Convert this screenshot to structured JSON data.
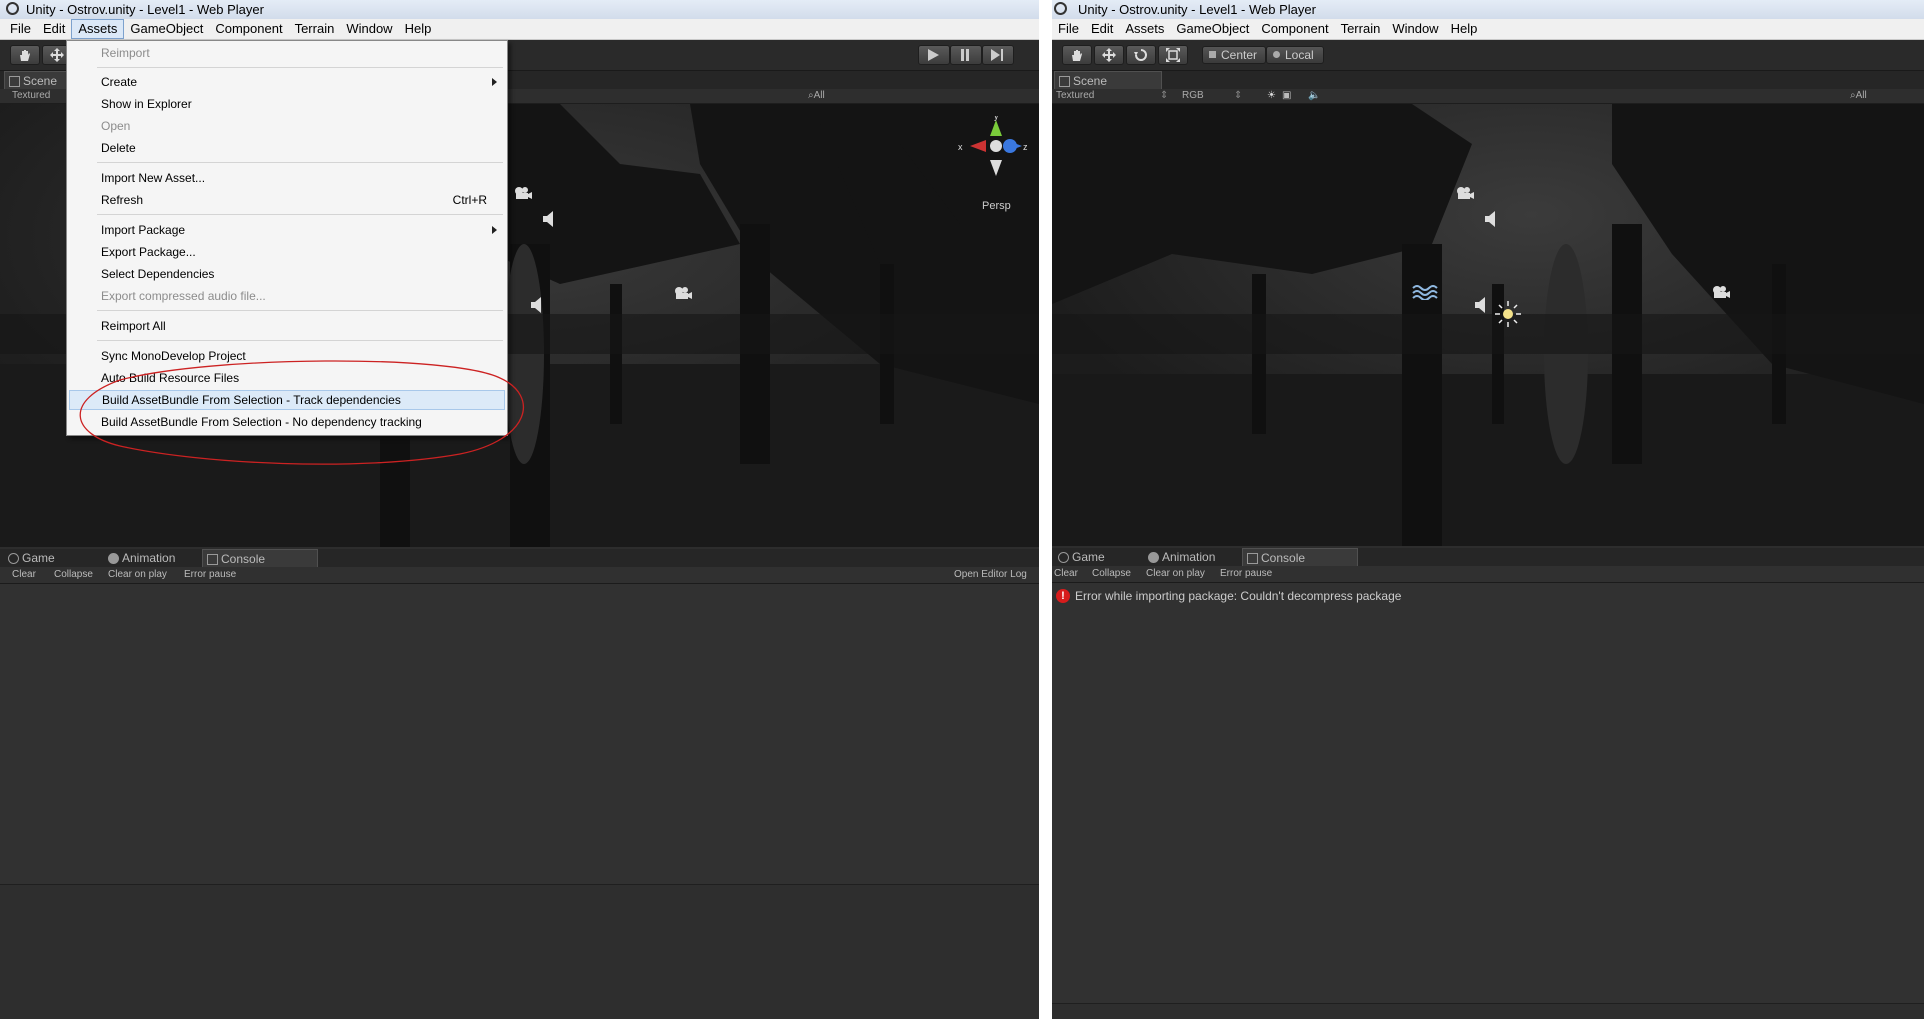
{
  "left": {
    "title": "Unity - Ostrov.unity - Level1 - Web Player",
    "menu": [
      "File",
      "Edit",
      "Assets",
      "GameObject",
      "Component",
      "Terrain",
      "Window",
      "Help"
    ],
    "scene_tab": "Scene",
    "render_mode": "Textured",
    "search_placeholder": "All",
    "gizmo": {
      "y": "y",
      "x": "x",
      "z": "z",
      "persp": "Persp"
    },
    "bottom_tabs": [
      "Game",
      "Animation",
      "Console"
    ],
    "console_buttons": [
      "Clear",
      "Collapse",
      "Clear on play",
      "Error pause"
    ],
    "open_editor_log": "Open Editor Log",
    "assets_menu": {
      "items": [
        {
          "label": "Reimport",
          "disabled": true
        },
        {
          "label": "Create",
          "submenu": true
        },
        {
          "label": "Show in Explorer"
        },
        {
          "label": "Open",
          "disabled": true
        },
        {
          "label": "Delete"
        },
        {
          "label": "Import New Asset..."
        },
        {
          "label": "Refresh",
          "shortcut": "Ctrl+R"
        },
        {
          "label": "Import Package",
          "submenu": true
        },
        {
          "label": "Export Package..."
        },
        {
          "label": "Select Dependencies"
        },
        {
          "label": "Export compressed audio file...",
          "disabled": true
        },
        {
          "label": "Reimport All"
        },
        {
          "label": "Sync MonoDevelop Project"
        },
        {
          "label": "Auto Build Resource Files"
        },
        {
          "label": "Build AssetBundle From Selection - Track dependencies",
          "highlighted": true
        },
        {
          "label": "Build AssetBundle From Selection - No dependency tracking"
        }
      ]
    }
  },
  "right": {
    "title": "Unity - Ostrov.unity - Level1 - Web Player",
    "menu": [
      "File",
      "Edit",
      "Assets",
      "GameObject",
      "Component",
      "Terrain",
      "Window",
      "Help"
    ],
    "pivot_center": "Center",
    "pivot_local": "Local",
    "scene_tab": "Scene",
    "render_mode": "Textured",
    "color_mode": "RGB",
    "search_placeholder": "All",
    "bottom_tabs": [
      "Game",
      "Animation",
      "Console"
    ],
    "console_buttons": [
      "Clear",
      "Collapse",
      "Clear on play",
      "Error pause"
    ],
    "error_message": "Error while importing package: Couldn't decompress package"
  },
  "colors": {
    "annotation": "#cc2222",
    "error": "#d71c1c",
    "highlight": "#dceaf8"
  }
}
